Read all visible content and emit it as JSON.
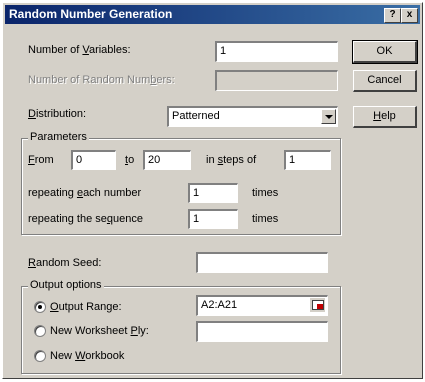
{
  "window": {
    "title": "Random Number Generation",
    "help_glyph": "?",
    "close_glyph": "x"
  },
  "labels": {
    "num_variables_pre": "Number of ",
    "num_variables_u": "V",
    "num_variables_post": "ariables:",
    "num_random_pre": "Number of Random Num",
    "num_random_u": "b",
    "num_random_post": "ers:",
    "distribution_u": "D",
    "distribution_post": "istribution:",
    "random_seed_u": "R",
    "random_seed_post": "andom Seed:"
  },
  "fields": {
    "num_variables": "1",
    "num_random": "",
    "distribution": "Patterned",
    "random_seed": "",
    "output_range": "A2:A21",
    "new_worksheet_ply": ""
  },
  "buttons": {
    "ok": "OK",
    "cancel": "Cancel",
    "help_u": "H",
    "help_post": "elp"
  },
  "parameters": {
    "legend": "Parameters",
    "from_u": "F",
    "from_post": "rom",
    "from_value": "0",
    "to_u": "t",
    "to_post": "o",
    "to_value": "20",
    "steps_pre": "in ",
    "steps_u": "s",
    "steps_post": "teps of",
    "steps_value": "1",
    "repeat_each_pre": "repeating ",
    "repeat_each_u": "e",
    "repeat_each_post": "ach number",
    "repeat_each_value": "1",
    "repeat_each_unit": "times",
    "repeat_seq_pre": "repeating the se",
    "repeat_seq_u": "q",
    "repeat_seq_post": "uence",
    "repeat_seq_value": "1",
    "repeat_seq_unit": "times"
  },
  "output": {
    "legend": "Output options",
    "range_u": "O",
    "range_post": "utput Range:",
    "ply_pre": "New Worksheet ",
    "ply_u": "P",
    "ply_post": "ly:",
    "workbook_pre": "New ",
    "workbook_u": "W",
    "workbook_post": "orkbook",
    "selected": "output-range"
  }
}
